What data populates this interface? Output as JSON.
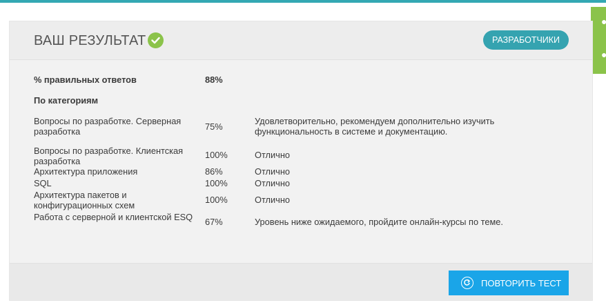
{
  "header": {
    "title": "ВАШ РЕЗУЛЬТАТ",
    "badge_label": "РАЗРАБОТЧИКИ"
  },
  "summary": {
    "label": "% правильных ответов",
    "value": "88%"
  },
  "categories_heading": "По категориям",
  "categories": [
    {
      "name": "Вопросы по разработке. Серверная разработка",
      "score": "75%",
      "comment": "Удовлетворительно, рекомендуем дополнительно изучить функциональность в системе и документацию."
    },
    {
      "name": "Вопросы по разработке. Клиентская разработка",
      "score": "100%",
      "comment": "Отлично"
    },
    {
      "name": "Архитектура приложения",
      "score": "86%",
      "comment": "Отлично"
    },
    {
      "name": "SQL",
      "score": "100%",
      "comment": "Отлично"
    },
    {
      "name": "Архитектура пакетов и конфигурационных схем",
      "score": "100%",
      "comment": "Отлично"
    },
    {
      "name": "Работа с серверной и клиентской ESQ",
      "score": "67%",
      "comment": "Уровень ниже ожидаемого, пройдите онлайн-курсы по теме."
    }
  ],
  "footer": {
    "retry_label": "ПОВТОРИТЬ ТЕСТ"
  },
  "colors": {
    "accent_teal": "#35a3b0",
    "success_green": "#8bc34a",
    "button_blue": "#1aa5e8"
  }
}
